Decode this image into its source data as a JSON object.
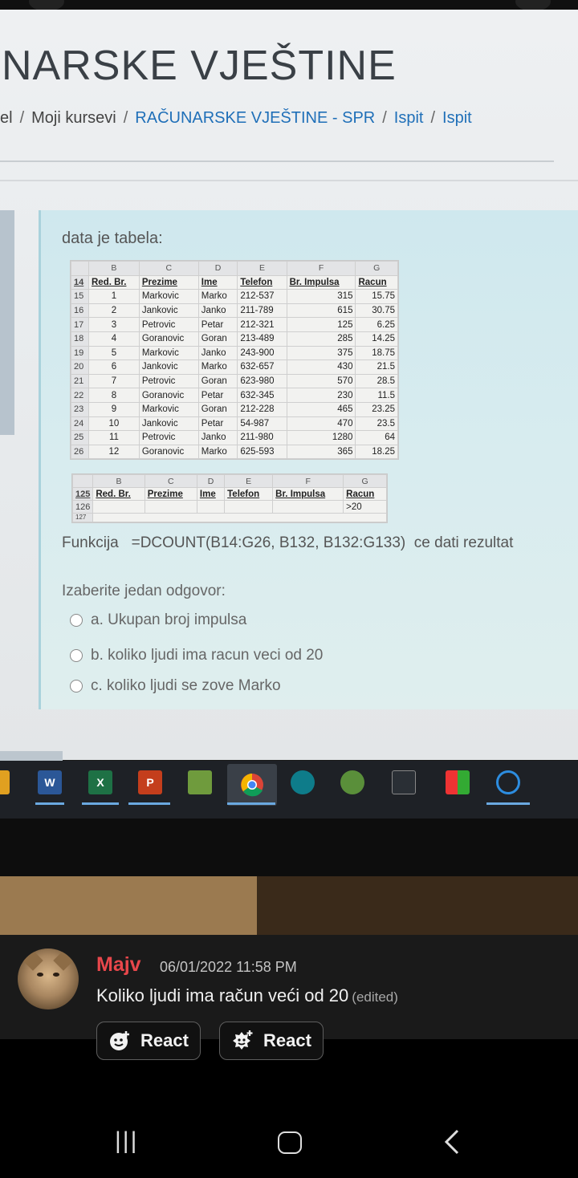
{
  "screen": {
    "page_title": "NARSKE VJEŠTINE",
    "breadcrumb": {
      "item0": "el",
      "item1": "Moji kursevi",
      "item2": "RAČUNARSKE VJEŠTINE - SPR",
      "item3": "Ispit",
      "item4": "Ispit",
      "sep": "/"
    },
    "question": {
      "intro": "data je tabela:",
      "function_label": "Funkcija",
      "function_formula": "=DCOUNT(B14:G26, B132, B132:G133)",
      "function_suffix": "ce dati rezultat",
      "choose_label": "Izaberite jedan odgovor:",
      "options": [
        "a. Ukupan broj impulsa",
        "b. koliko ljudi ima racun veci od 20",
        "c. koliko ljudi se zove Marko"
      ]
    },
    "sheet": {
      "col_letters": [
        "",
        "B",
        "C",
        "D",
        "E",
        "F",
        "G"
      ],
      "header_row_num": "14",
      "headers": [
        "Red. Br.",
        "Prezime",
        "Ime",
        "Telefon",
        "Br. Impulsa",
        "Racun"
      ],
      "rows": [
        {
          "r": "15",
          "c": [
            "1",
            "Markovic",
            "Marko",
            "212-537",
            "315",
            "15.75"
          ]
        },
        {
          "r": "16",
          "c": [
            "2",
            "Jankovic",
            "Janko",
            "211-789",
            "615",
            "30.75"
          ]
        },
        {
          "r": "17",
          "c": [
            "3",
            "Petrovic",
            "Petar",
            "212-321",
            "125",
            "6.25"
          ]
        },
        {
          "r": "18",
          "c": [
            "4",
            "Goranovic",
            "Goran",
            "213-489",
            "285",
            "14.25"
          ]
        },
        {
          "r": "19",
          "c": [
            "5",
            "Markovic",
            "Janko",
            "243-900",
            "375",
            "18.75"
          ]
        },
        {
          "r": "20",
          "c": [
            "6",
            "Jankovic",
            "Marko",
            "632-657",
            "430",
            "21.5"
          ]
        },
        {
          "r": "21",
          "c": [
            "7",
            "Petrovic",
            "Goran",
            "623-980",
            "570",
            "28.5"
          ]
        },
        {
          "r": "22",
          "c": [
            "8",
            "Goranovic",
            "Petar",
            "632-345",
            "230",
            "11.5"
          ]
        },
        {
          "r": "23",
          "c": [
            "9",
            "Markovic",
            "Goran",
            "212-228",
            "465",
            "23.25"
          ]
        },
        {
          "r": "24",
          "c": [
            "10",
            "Jankovic",
            "Petar",
            "54-987",
            "470",
            "23.5"
          ]
        },
        {
          "r": "25",
          "c": [
            "11",
            "Petrovic",
            "Janko",
            "211-980",
            "1280",
            "64"
          ]
        },
        {
          "r": "26",
          "c": [
            "12",
            "Goranovic",
            "Marko",
            "625-593",
            "365",
            "18.25"
          ]
        }
      ]
    },
    "criteria_sheet": {
      "col_letters": [
        "",
        "B",
        "C",
        "D",
        "E",
        "F",
        "G"
      ],
      "header_row_num": "125",
      "headers": [
        "Red. Br.",
        "Prezime",
        "Ime",
        "Telefon",
        "Br. Impulsa",
        "Racun"
      ],
      "row_num": "126",
      "criteria_value": ">20",
      "cut_row_num": "127"
    }
  },
  "taskbar": {
    "icons": [
      "word-icon",
      "excel-icon",
      "powerpoint-icon",
      "image-app-icon",
      "chrome-icon",
      "arduino-icon",
      "android-icon",
      "terminal-icon",
      "colorful-grid-icon",
      "sync-icon"
    ],
    "labels": {
      "word": "W",
      "excel": "X",
      "powerpoint": "P"
    }
  },
  "chat": {
    "username": "Majv",
    "timestamp": "06/01/2022 11:58 PM",
    "message": "Koliko ljudi ima račun veći od 20",
    "edited": "(edited)",
    "react_label_1": "React",
    "react_label_2": "React",
    "colors": {
      "username": "#e8474b"
    }
  },
  "navbar": {
    "recent": "|||",
    "home": "home",
    "back": "<"
  }
}
